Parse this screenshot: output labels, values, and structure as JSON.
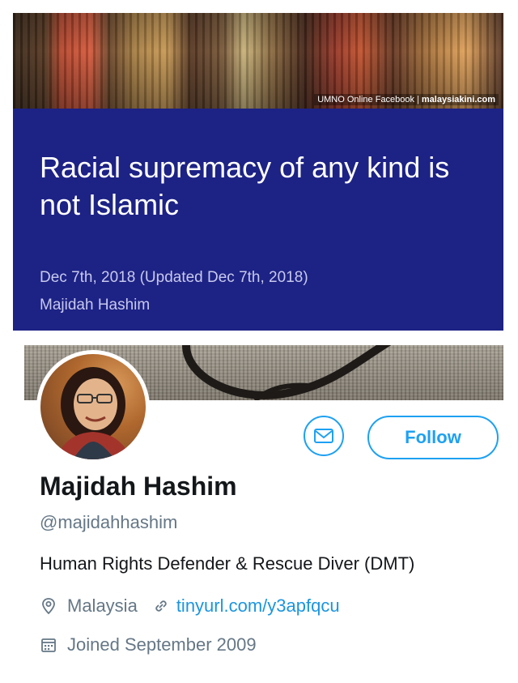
{
  "article": {
    "image_credit": {
      "source": "UMNO Online Facebook",
      "outlet": "malaysiakini.com"
    },
    "title": "Racial supremacy of any kind is not Islamic",
    "date": "Dec 7th, 2018 (Updated Dec 7th, 2018)",
    "author": "Majidah Hashim"
  },
  "profile": {
    "name": "Majidah Hashim",
    "handle": "@majidahhashim",
    "bio": "Human Rights Defender & Rescue Diver (DMT)",
    "location": "Malaysia",
    "link": "tinyurl.com/y3apfqcu",
    "joined": "Joined September 2009",
    "follow_label": "Follow"
  },
  "colors": {
    "article_bg": "#1d2285",
    "accent": "#1da1f2",
    "secondary_text": "#657786"
  },
  "icons": {
    "message": "envelope-icon",
    "location": "map-pin-icon",
    "link": "link-icon",
    "calendar": "calendar-icon"
  }
}
